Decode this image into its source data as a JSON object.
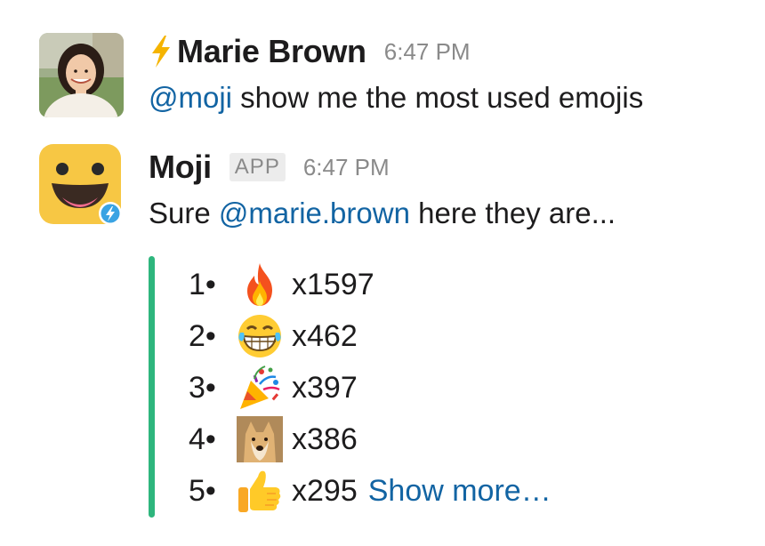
{
  "messages": [
    {
      "sender": "Marie Brown",
      "time": "6:47 PM",
      "mention": "@moji",
      "text": " show me the most used emojis"
    },
    {
      "sender": "Moji",
      "badge": "APP",
      "time": "6:47 PM",
      "prefix": "Sure ",
      "mention": "@marie.brown",
      "suffix": " here they are..."
    }
  ],
  "emoji_ranking": {
    "items": [
      {
        "rank": "1•",
        "emoji": "fire-icon",
        "count": "x1597"
      },
      {
        "rank": "2•",
        "emoji": "laughing-icon",
        "count": "x462"
      },
      {
        "rank": "3•",
        "emoji": "party-popper-icon",
        "count": "x397"
      },
      {
        "rank": "4•",
        "emoji": "doge-icon",
        "count": "x386"
      },
      {
        "rank": "5•",
        "emoji": "thumbs-up-icon",
        "count": "x295"
      }
    ],
    "show_more": "Show more…"
  },
  "colors": {
    "mention": "#1264a3",
    "attachment_bar": "#2eb67d",
    "bolt": "#f5b400",
    "moji_avatar": "#f7c744"
  }
}
